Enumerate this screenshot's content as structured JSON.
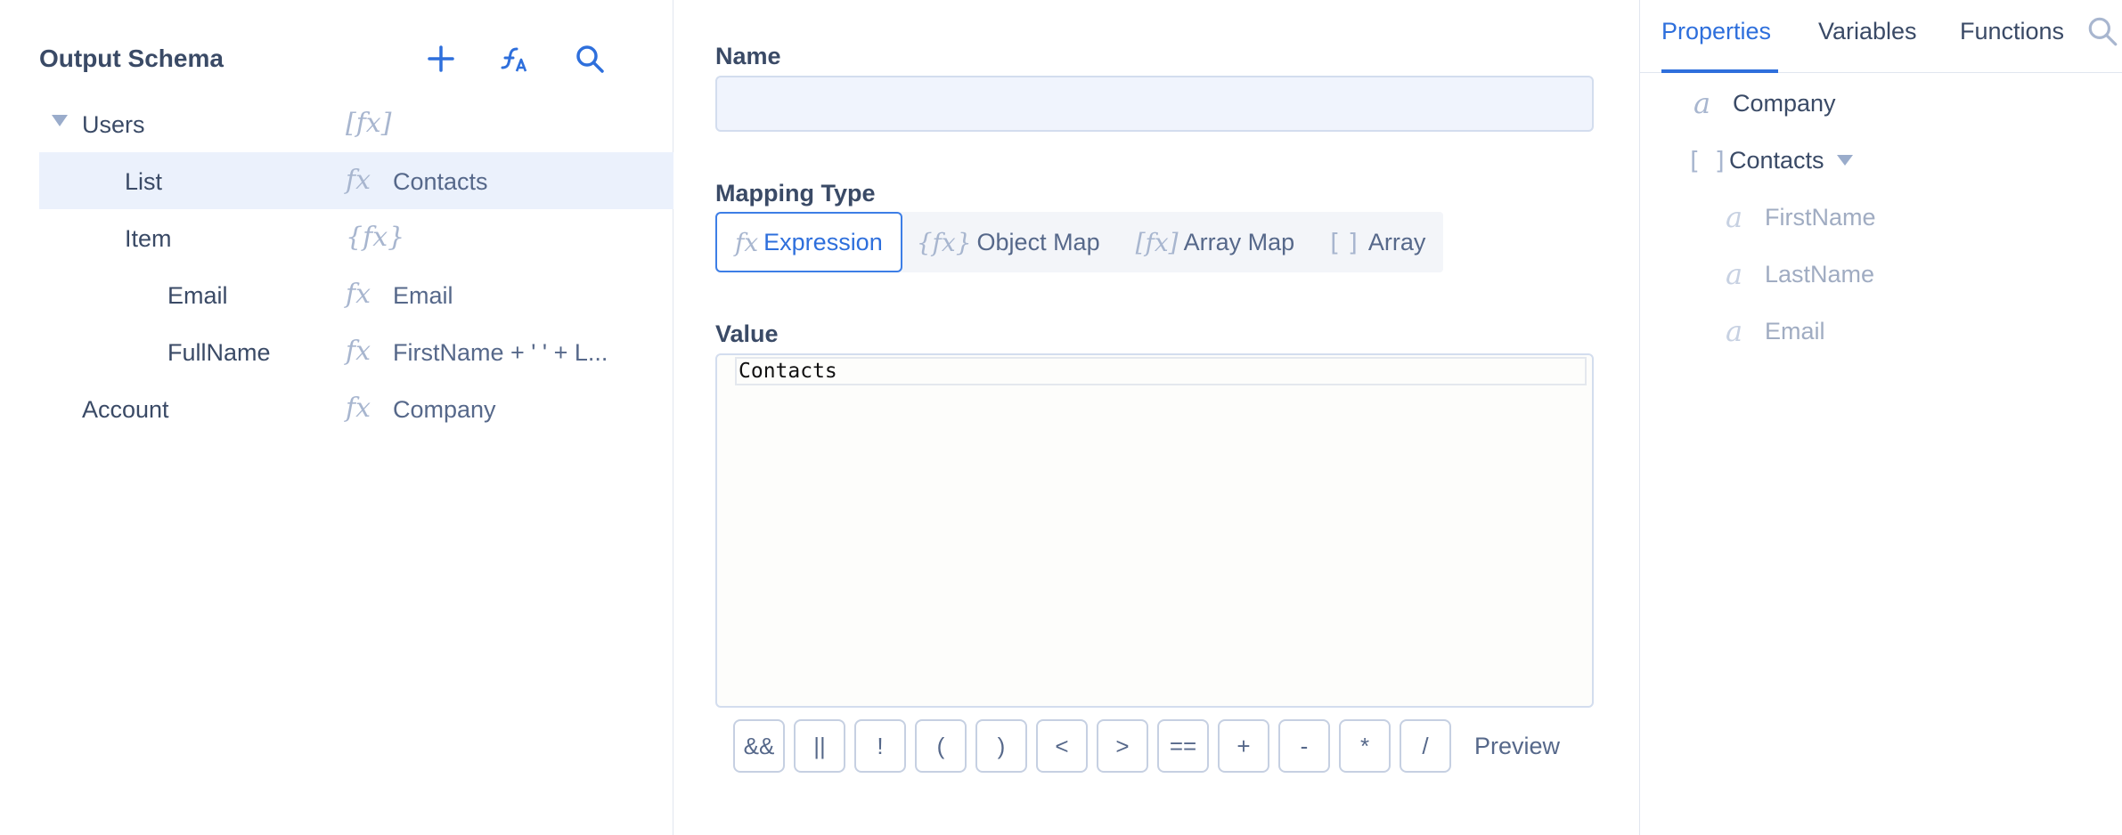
{
  "output_schema": {
    "title": "Output Schema",
    "tools": [
      "add-icon",
      "map-function-icon",
      "search-icon"
    ],
    "tree": [
      {
        "name": "Users",
        "icon": "[fx]",
        "value": ""
      },
      {
        "name": "List",
        "icon": "fx",
        "value": "Contacts"
      },
      {
        "name": "Item",
        "icon": "{fx}",
        "value": ""
      },
      {
        "name": "Email",
        "icon": "fx",
        "value": "Email"
      },
      {
        "name": "FullName",
        "icon": "fx",
        "value": "FirstName + ' ' + L..."
      },
      {
        "name": "Account",
        "icon": "fx",
        "value": "Company"
      }
    ]
  },
  "editor": {
    "name_label": "Name",
    "name_value": "",
    "mapping_type_label": "Mapping Type",
    "mapping_types": [
      {
        "icon": "fx",
        "label": "Expression"
      },
      {
        "icon": "{fx}",
        "label": "Object Map"
      },
      {
        "icon": "[fx]",
        "label": "Array Map"
      },
      {
        "icon": "[ ]",
        "label": "Array"
      }
    ],
    "value_label": "Value",
    "value_text": "Contacts",
    "operators": [
      "&&",
      "||",
      "!",
      "(",
      ")",
      "<",
      ">",
      "==",
      "+",
      "-",
      "*",
      "/"
    ],
    "preview_label": "Preview"
  },
  "properties_panel": {
    "tabs": [
      "Properties",
      "Variables",
      "Functions"
    ],
    "items": [
      {
        "icon": "a",
        "name": "Company"
      },
      {
        "icon": "[ ]",
        "name": "Contacts"
      },
      {
        "icon": "a",
        "name": "FirstName"
      },
      {
        "icon": "a",
        "name": "LastName"
      },
      {
        "icon": "a",
        "name": "Email"
      }
    ]
  },
  "colors": {
    "accent": "#2e6fdc",
    "selected_row": "#ebf1fc",
    "icon_muted": "#a8b6cf"
  }
}
